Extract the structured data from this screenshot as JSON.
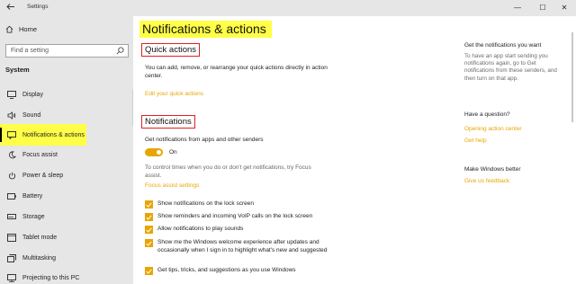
{
  "window": {
    "title": "Settings",
    "controls": {
      "minimize": "—",
      "maximize": "☐",
      "close": "✕"
    }
  },
  "sidebar": {
    "home_label": "Home",
    "search_placeholder": "Find a setting",
    "section_label": "System",
    "items": [
      {
        "label": "Display",
        "icon": "monitor-icon"
      },
      {
        "label": "Sound",
        "icon": "speaker-icon"
      },
      {
        "label": "Notifications & actions",
        "icon": "notification-icon",
        "active": true
      },
      {
        "label": "Focus assist",
        "icon": "moon-icon"
      },
      {
        "label": "Power & sleep",
        "icon": "power-icon"
      },
      {
        "label": "Battery",
        "icon": "battery-icon"
      },
      {
        "label": "Storage",
        "icon": "storage-icon"
      },
      {
        "label": "Tablet mode",
        "icon": "tablet-icon"
      },
      {
        "label": "Multitasking",
        "icon": "multitasking-icon"
      },
      {
        "label": "Projecting to this PC",
        "icon": "projecting-icon"
      }
    ]
  },
  "main": {
    "title": "Notifications & actions",
    "quick_actions": {
      "heading": "Quick actions",
      "description": "You can add, remove, or rearrange your quick actions directly in action center.",
      "edit_link": "Edit your quick actions"
    },
    "notifications": {
      "heading": "Notifications",
      "get_notifications_label": "Get notifications from apps and other senders",
      "toggle_state": "On",
      "focus_text": "To control times when you do or don't get notifications, try Focus assist.",
      "focus_link": "Focus assist settings",
      "checkboxes": [
        {
          "label": "Show notifications on the lock screen",
          "checked": true
        },
        {
          "label": "Show reminders and incoming VoIP calls on the lock screen",
          "checked": true
        },
        {
          "label": "Allow notifications to play sounds",
          "checked": true
        },
        {
          "label": "Show me the Windows welcome experience after updates and occasionally when I sign in to highlight what's new and suggested",
          "checked": true
        },
        {
          "label": "Get tips, tricks, and suggestions as you use Windows",
          "checked": true
        }
      ]
    }
  },
  "right": {
    "get_notifications_heading": "Get the notifications you want",
    "get_notifications_text": "To have an app start sending you notifications again, go to Get notifications from these senders, and then turn on that app.",
    "question_heading": "Have a question?",
    "links": [
      "Opening action center",
      "Get help"
    ],
    "better_heading": "Make Windows better",
    "feedback_link": "Give us feedback"
  },
  "colors": {
    "accent": "#e8a500",
    "highlight": "#ffff47",
    "annotation_box": "#e02020",
    "sidebar_bg": "#e6e6e6"
  }
}
